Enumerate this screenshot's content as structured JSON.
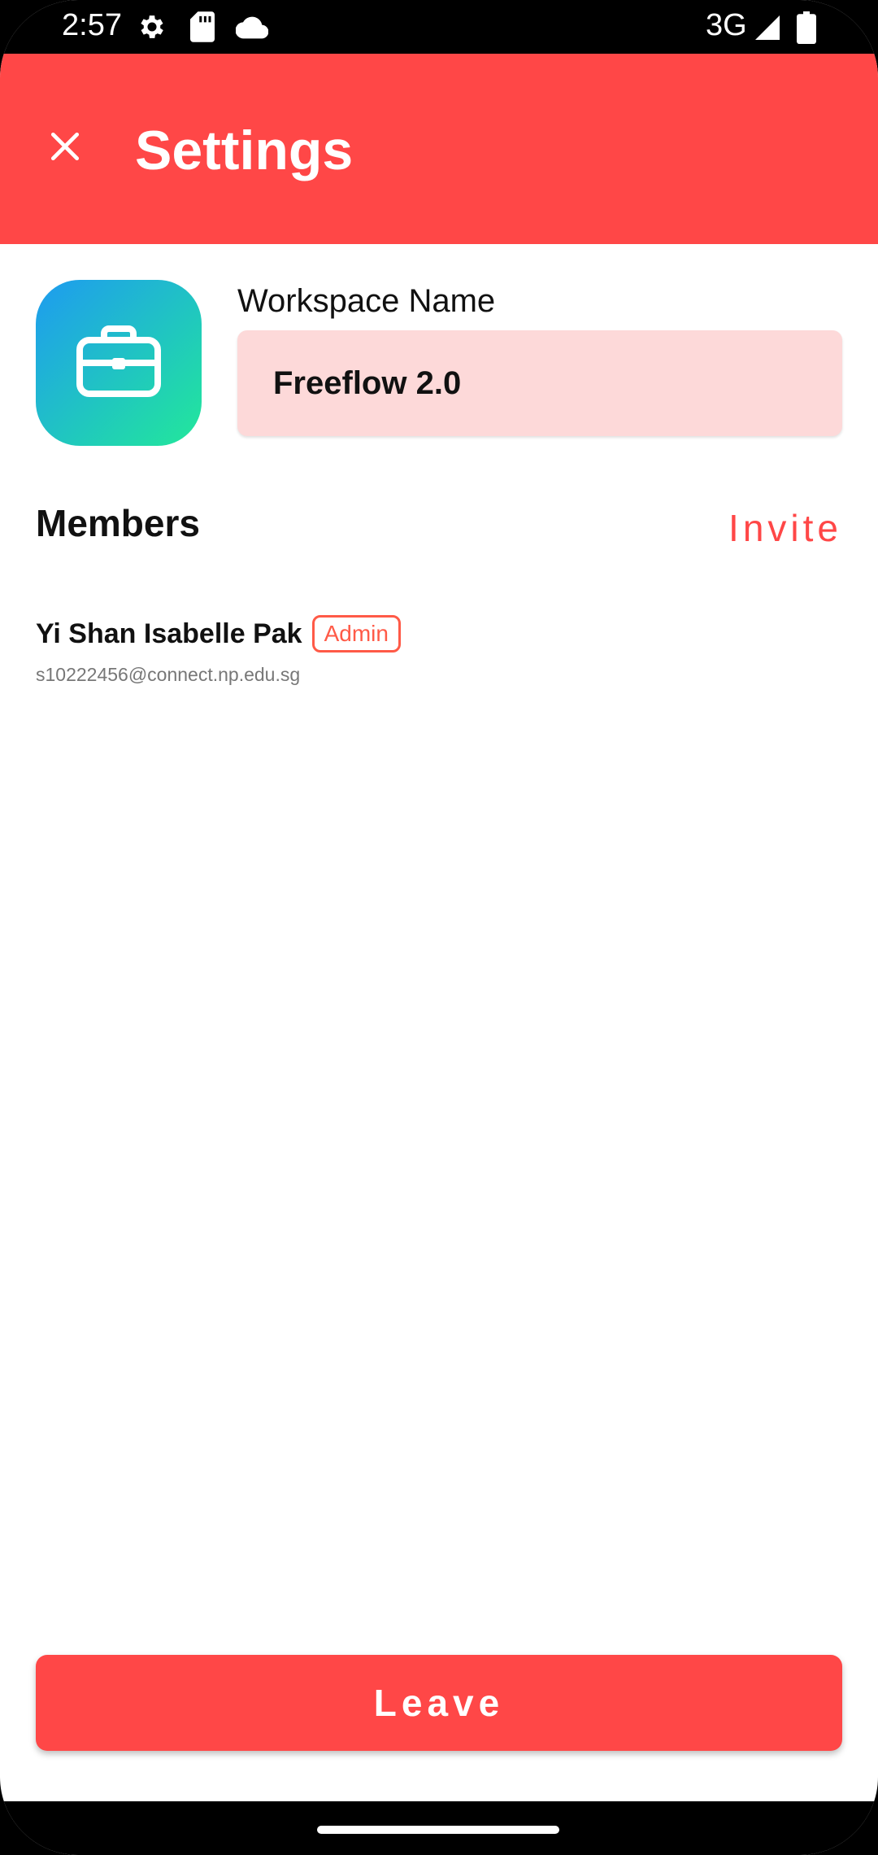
{
  "status_bar": {
    "time": "2:57",
    "network": "3G",
    "icons": [
      "gear-icon",
      "sd-card-icon",
      "cloud-icon",
      "signal-icon",
      "battery-icon"
    ]
  },
  "app_bar": {
    "title": "Settings",
    "close_icon": "close-icon",
    "color": "#ff4747"
  },
  "workspace": {
    "icon": "briefcase-icon",
    "name_label": "Workspace Name",
    "name_value": "Freeflow 2.0"
  },
  "members": {
    "title": "Members",
    "invite_label": "Invite",
    "items": [
      {
        "name": "Yi Shan Isabelle Pak",
        "role": "Admin",
        "email": "s10222456@connect.np.edu.sg"
      }
    ]
  },
  "actions": {
    "leave_label": "Leave"
  },
  "colors": {
    "accent": "#ff4747",
    "input_bg": "#fdd9d9",
    "badge": "#ff5a47"
  }
}
